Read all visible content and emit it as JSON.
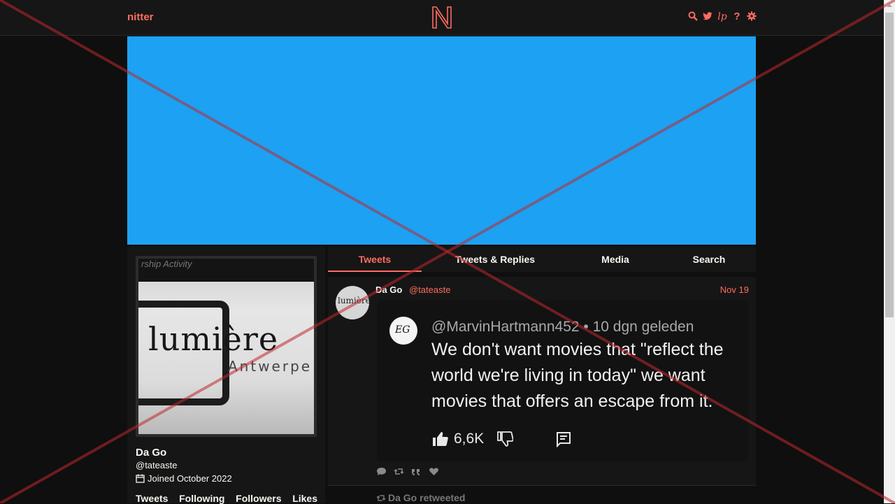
{
  "nav": {
    "brand": "nitter",
    "logo_letter": "N",
    "icons": [
      "search-icon",
      "twitter-bird-icon",
      "lp-icon",
      "help-icon",
      "settings-gear-icon"
    ],
    "lp_label": "lp",
    "help_label": "?"
  },
  "banner": {
    "color": "#1da1f2"
  },
  "profile": {
    "avatar_texts": {
      "top_strip": "rship Activity",
      "word": "lumière",
      "sub": "Antwerpe"
    },
    "name": "Da Go",
    "handle": "@tateaste",
    "joined": "Joined October 2022",
    "stats": [
      "Tweets",
      "Following",
      "Followers",
      "Likes"
    ]
  },
  "tabs": [
    {
      "label": "Tweets",
      "active": true
    },
    {
      "label": "Tweets & Replies",
      "active": false
    },
    {
      "label": "Media",
      "active": false
    },
    {
      "label": "Search",
      "active": false
    }
  ],
  "tweet": {
    "author_name": "Da Go",
    "author_handle": "@tateaste",
    "date": "Nov 19",
    "avatar_text": "lumière",
    "media": {
      "avatar_text": "EG",
      "meta": "@MarvinHartmann452 • 10 dgn geleden",
      "text": "We don't want movies that \"reflect the world we're living in today\" we want movies that offers an escape from it.",
      "likes": "6,6K"
    },
    "stat_icons": [
      "comment-icon",
      "retweet-icon",
      "quote-icon",
      "heart-icon"
    ]
  },
  "next": {
    "retweet_label": "Da Go retweeted"
  },
  "colors": {
    "accent": "#ff6c60",
    "background": "#0f0f0f",
    "panel": "#161616",
    "overlay_red": "#c0282d"
  }
}
